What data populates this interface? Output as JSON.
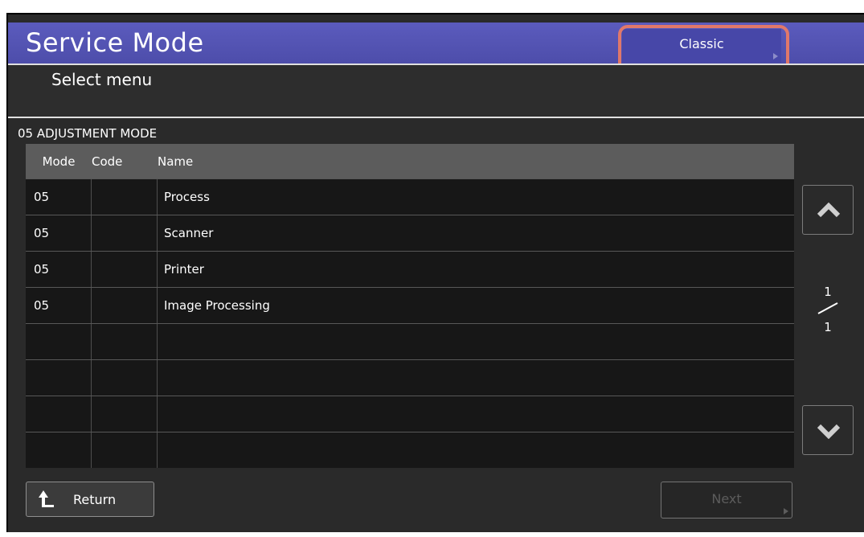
{
  "header": {
    "title": "Service Mode",
    "classic_label": "Classic"
  },
  "subheader": {
    "title": "Select menu"
  },
  "section": {
    "title": "05 ADJUSTMENT MODE"
  },
  "table": {
    "columns": [
      "Mode",
      "Code",
      "Name"
    ],
    "rows": [
      {
        "mode": "05",
        "code": "",
        "name": "Process"
      },
      {
        "mode": "05",
        "code": "",
        "name": "Scanner"
      },
      {
        "mode": "05",
        "code": "",
        "name": "Printer"
      },
      {
        "mode": "05",
        "code": "",
        "name": "Image Processing"
      },
      {
        "mode": "",
        "code": "",
        "name": ""
      },
      {
        "mode": "",
        "code": "",
        "name": ""
      },
      {
        "mode": "",
        "code": "",
        "name": ""
      },
      {
        "mode": "",
        "code": "",
        "name": ""
      }
    ]
  },
  "pager": {
    "current": "1",
    "total": "1"
  },
  "footer": {
    "return_label": "Return",
    "next_label": "Next"
  },
  "icons": {
    "up": "chevron-up-icon",
    "down": "chevron-down-icon",
    "return": "return-arrow-icon"
  },
  "colors": {
    "title_bar": "#5252b0",
    "highlight": "#e0786a",
    "panel": "#2a2a2a"
  }
}
